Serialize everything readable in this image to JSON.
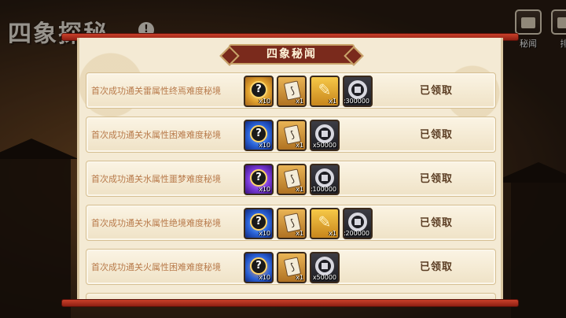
{
  "game": {
    "bg_title": "四象探秘",
    "help_label": "!",
    "side_buttons": [
      {
        "label": "秘闻",
        "icon": "book-icon"
      },
      {
        "label": "排",
        "icon": "ranking-icon"
      }
    ]
  },
  "panel": {
    "title": "四象秘闻",
    "rows": [
      {
        "desc": "首次成功通关雷属性终焉难度秘境",
        "status": "已领取",
        "rewards": [
          {
            "icon": "mystery-orb-icon",
            "style": "orb-gold",
            "qty": "x10"
          },
          {
            "icon": "scroll-icon",
            "style": "scroll",
            "qty": "x1"
          },
          {
            "icon": "brush-icon",
            "style": "brush",
            "qty": "x1"
          },
          {
            "icon": "coin-icon",
            "style": "coin",
            "qty": "x300000"
          }
        ]
      },
      {
        "desc": "首次成功通关水属性困难难度秘境",
        "status": "已领取",
        "rewards": [
          {
            "icon": "mystery-orb-icon",
            "style": "orb-blue",
            "qty": "x10"
          },
          {
            "icon": "scroll-icon",
            "style": "scroll",
            "qty": "x1"
          },
          {
            "icon": "coin-icon",
            "style": "coin",
            "qty": "x50000"
          }
        ]
      },
      {
        "desc": "首次成功通关水属性噩梦难度秘境",
        "status": "已领取",
        "rewards": [
          {
            "icon": "mystery-orb-icon",
            "style": "orb-purple",
            "qty": "x10"
          },
          {
            "icon": "scroll-icon",
            "style": "scroll",
            "qty": "x1"
          },
          {
            "icon": "coin-icon",
            "style": "coin",
            "qty": "x100000"
          }
        ]
      },
      {
        "desc": "首次成功通关水属性绝境难度秘境",
        "status": "已领取",
        "rewards": [
          {
            "icon": "mystery-orb-icon",
            "style": "orb-blue",
            "qty": "x10"
          },
          {
            "icon": "scroll-icon",
            "style": "scroll",
            "qty": "x1"
          },
          {
            "icon": "brush-icon",
            "style": "brush",
            "qty": "x1"
          },
          {
            "icon": "coin-icon",
            "style": "coin",
            "qty": "x200000"
          }
        ]
      },
      {
        "desc": "首次成功通关火属性困难难度秘境",
        "status": "已领取",
        "rewards": [
          {
            "icon": "mystery-orb-icon",
            "style": "orb-fire",
            "qty": "x10"
          },
          {
            "icon": "scroll-icon",
            "style": "scroll",
            "qty": "x1"
          },
          {
            "icon": "coin-icon",
            "style": "coin",
            "qty": "x50000"
          }
        ]
      }
    ]
  },
  "colors": {
    "rod": "#8e1f12",
    "panel_bg": "#f4ead4",
    "desc_text": "#b87a4a",
    "status_text": "#5a3c22",
    "header_bg": "#7a2a1c"
  }
}
